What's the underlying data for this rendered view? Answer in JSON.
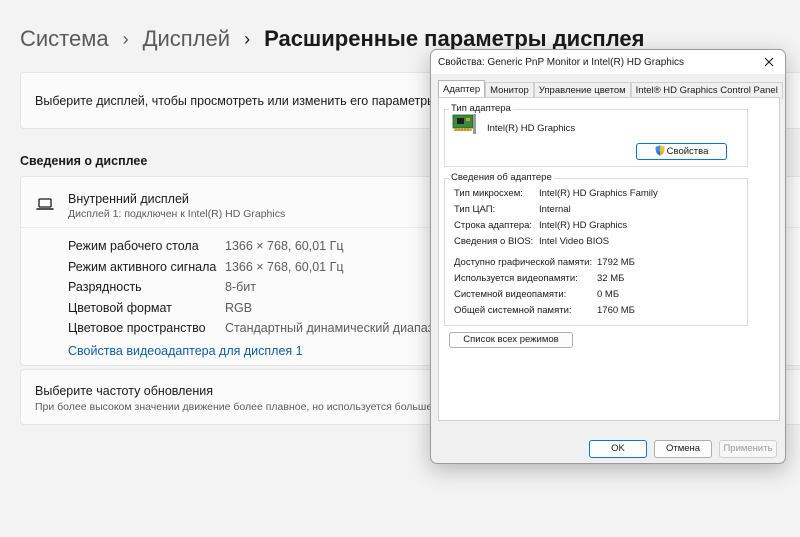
{
  "breadcrumb": {
    "items": [
      "Система",
      "Дисплей",
      "Расширенные параметры дисплея"
    ]
  },
  "select_display": {
    "text": "Выберите дисплей, чтобы просмотреть или изменить его параметры"
  },
  "display_info": {
    "section_title": "Сведения о дисплее",
    "monitor_name": "Внутренний дисплей",
    "monitor_sub": "Дисплей 1: подключен к Intel(R) HD Graphics",
    "rows": [
      {
        "label": "Режим рабочего стола",
        "value": "1366 × 768, 60,01 Гц"
      },
      {
        "label": "Режим активного сигнала",
        "value": "1366 × 768, 60,01 Гц"
      },
      {
        "label": "Разрядность",
        "value": "8-бит"
      },
      {
        "label": "Цветовой формат",
        "value": "RGB"
      },
      {
        "label": "Цветовое пространство",
        "value": "Стандартный динамический диапазон ("
      }
    ],
    "adapter_link": "Свойства видеоадаптера для дисплея 1"
  },
  "refresh": {
    "title": "Выберите частоту обновления",
    "subtitle": "При более высоком значении движение более плавное, но используется больше энер"
  },
  "dialog": {
    "title": "Свойства: Generic PnP Monitor и Intel(R) HD Graphics",
    "tabs": [
      "Адаптер",
      "Монитор",
      "Управление цветом",
      "Intel® HD Graphics Control Panel"
    ],
    "adapter_type_legend": "Тип адаптера",
    "adapter_name": "Intel(R) HD Graphics",
    "properties_button": "Свойства",
    "adapter_info_legend": "Сведения об адаптере",
    "info_rows": [
      {
        "label": "Тип микросхем:",
        "value": "Intel(R) HD Graphics Family"
      },
      {
        "label": "Тип ЦАП:",
        "value": "Internal"
      },
      {
        "label": "Строка адаптера:",
        "value": "Intel(R) HD Graphics"
      },
      {
        "label": "Сведения о BIOS:",
        "value": "Intel Video BIOS"
      }
    ],
    "memory_rows": [
      {
        "label": "Доступно графической памяти:",
        "value": "1792 МБ"
      },
      {
        "label": "Используется видеопамяти:",
        "value": "32 МБ"
      },
      {
        "label": "Системной видеопамяти:",
        "value": "0 МБ"
      },
      {
        "label": "Общей системной памяти:",
        "value": "1760 МБ"
      }
    ],
    "list_modes_button": "Список всех режимов",
    "ok_button": "OK",
    "cancel_button": "Отмена",
    "apply_button": "Применить"
  }
}
